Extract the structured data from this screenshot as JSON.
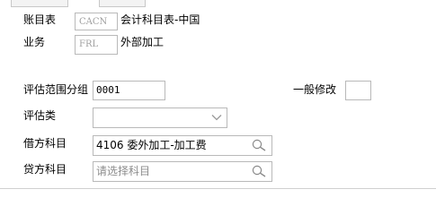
{
  "account_table": {
    "label": "账目表",
    "code": "CACN",
    "name": "会计科目表-中国"
  },
  "business": {
    "label": "业务",
    "code": "FRL",
    "name": "外部加工"
  },
  "valuation_scope_group": {
    "label": "评估范围分组",
    "value": "0001"
  },
  "general_modification": {
    "label": "一般修改",
    "value": ""
  },
  "valuation_class": {
    "label": "评估类",
    "value": ""
  },
  "debit_account": {
    "label": "借方科目",
    "value": "4106 委外加工-加工费"
  },
  "credit_account": {
    "label": "贷方科目",
    "placeholder": "请选择科目"
  },
  "icons": {
    "lookup": "search-icon",
    "dropdown": "chevron-down-icon"
  }
}
